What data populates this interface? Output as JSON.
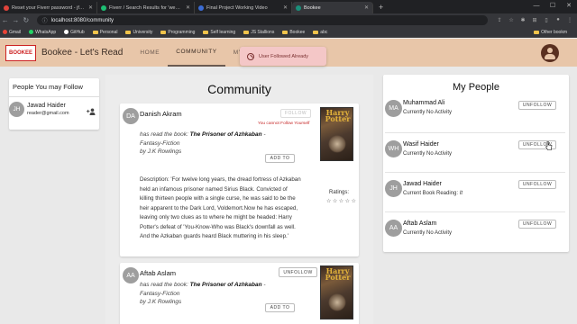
{
  "browser": {
    "tabs": [
      {
        "title": "Reset your Fiverr password - jfu...",
        "favicon_color": "#e0433b"
      },
      {
        "title": "Fiverr / Search Results for 'web d...",
        "favicon_color": "#1dbf73"
      },
      {
        "title": "Final Project Working Video",
        "favicon_color": "#3b6cd4"
      },
      {
        "title": "Bookee",
        "favicon_color": "#1a8f7a",
        "active": true
      }
    ],
    "new_tab": "+",
    "url_host": "localhost",
    "url_rest": ":8080/community",
    "bookmarks": [
      {
        "label": "Gmail",
        "kind": "dot",
        "color": "#ea4335"
      },
      {
        "label": "WhatsApp",
        "kind": "dot",
        "color": "#25d366"
      },
      {
        "label": "GitHub",
        "kind": "dot",
        "color": "#ffffff"
      },
      {
        "label": "Personal",
        "kind": "folder"
      },
      {
        "label": "University",
        "kind": "folder"
      },
      {
        "label": "Programming",
        "kind": "folder"
      },
      {
        "label": "Self learning",
        "kind": "folder"
      },
      {
        "label": "JS Stallions",
        "kind": "folder"
      },
      {
        "label": "Bookee",
        "kind": "folder"
      },
      {
        "label": "abc",
        "kind": "folder"
      }
    ],
    "other_bookmarks": "Other bookm"
  },
  "app": {
    "logo_text": "BOOKEE",
    "logo_sub": "Let's Read",
    "title": "Bookee - Let's Read",
    "nav": [
      {
        "label": "HOME",
        "active": false
      },
      {
        "label": "COMMUNITY",
        "active": true
      },
      {
        "label": "MY BOOKS",
        "active": false
      }
    ],
    "toast": "User Followed Already"
  },
  "left_panel": {
    "title": "People You may Follow",
    "person": {
      "initials": "JH",
      "name": "Jawad Haider",
      "email": "reader@gmail.com"
    }
  },
  "community": {
    "title": "Community",
    "cards": [
      {
        "initials": "DA",
        "name": "Danish Akram",
        "button": "FOLLOW",
        "note": "You cannot Follow Yourself",
        "read_prefix": "has read the book: ",
        "book": "The Prisoner of Azhkaban",
        "read_suffix": " - Fantasy-Fiction",
        "author": "by J.K Rowlings",
        "add_label": "ADD TO",
        "description": "Description: 'For twelve long years, the dread fortress of Azkaban held an infamous prisoner named Sirius Black. Convicted of killing thirteen people with a single curse, he was said to be the heir apparent to the Dark Lord, Voldemort.Now he has escaped, leaving only two clues as to where he might be headed: Harry Potter's defeat of 'You-Know-Who was Black's downfall as well. And the Azkaban guards heard Black muttering in his sleep.'",
        "cover_title": "Harry Potter",
        "ratings_label": "Ratings:",
        "stars": "☆☆☆☆☆"
      },
      {
        "initials": "AA",
        "name": "Aftab Aslam",
        "button": "UNFOLLOW",
        "read_prefix": "has read the book: ",
        "book": "The Prisoner of Azhkaban",
        "read_suffix": " - Fantasy-Fiction",
        "author": "by J.K Rowlings",
        "add_label": "ADD TO",
        "cover_title": "Harry Potter"
      }
    ]
  },
  "my_people": {
    "title": "My People",
    "people": [
      {
        "initials": "MA",
        "name": "Muhammad Ali",
        "status_prefix": "Currently No Activity",
        "status_book": "",
        "button": "UNFOLLOW"
      },
      {
        "initials": "WH",
        "name": "Wasif Haider",
        "status_prefix": "Currently No Activity",
        "status_book": "",
        "button": "UNFOLLOW"
      },
      {
        "initials": "JH",
        "name": "Jawad Haider",
        "status_prefix": "Current Book Reading: ",
        "status_book": "It",
        "button": "UNFOLLOW"
      },
      {
        "initials": "AA",
        "name": "Aftab Aslam",
        "status_prefix": "Currently No Activity",
        "status_book": "",
        "button": "UNFOLLOW"
      }
    ]
  }
}
